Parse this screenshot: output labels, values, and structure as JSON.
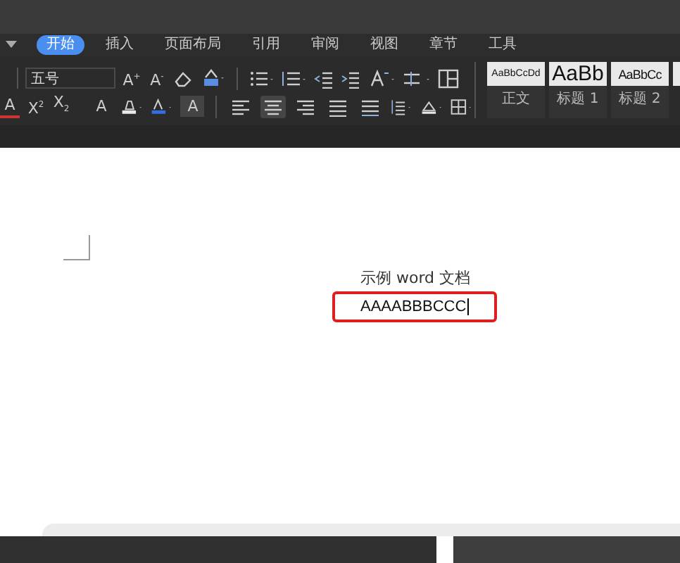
{
  "tabs": [
    {
      "label": "开始",
      "selected": true
    },
    {
      "label": "插入",
      "selected": false
    },
    {
      "label": "页面布局",
      "selected": false
    },
    {
      "label": "引用",
      "selected": false
    },
    {
      "label": "审阅",
      "selected": false
    },
    {
      "label": "视图",
      "selected": false
    },
    {
      "label": "章节",
      "selected": false
    },
    {
      "label": "工具",
      "selected": false
    }
  ],
  "toolbar": {
    "font_size": "五号",
    "glyphs_row_1": [
      "A$^{+}$",
      "A$^{-}$"
    ],
    "glyphs_row_2": [
      "A",
      "X$^{2}$",
      "X$_{2}$",
      "A",
      "A"
    ],
    "align_buttons": [
      {
        "selected": false
      },
      {
        "selected": true
      },
      {
        "selected": false
      },
      {
        "selected": false
      },
      {
        "selected": false
      }
    ]
  },
  "styles": [
    {
      "sample": "AaBbCcDd",
      "label": "正文",
      "kind": "small"
    },
    {
      "sample": "AaBb",
      "label": "标题 1",
      "kind": "large"
    },
    {
      "sample": "AaBbCc",
      "label": "标题 2",
      "kind": "medium"
    }
  ],
  "document": {
    "title": "示例 word 文档",
    "highlighted_text": "AAAABBBCCC"
  }
}
